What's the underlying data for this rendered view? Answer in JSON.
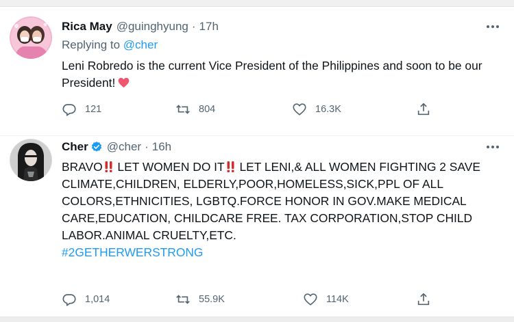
{
  "tweets": [
    {
      "display_name": "Rica May",
      "handle": "@guinghyung",
      "separator": "·",
      "time": "17h",
      "replying_prefix": "Replying to",
      "replying_to": "@cher",
      "text": "Leni Robredo is the current Vice President of the Philippines and soon to be our President!",
      "emoji": "heart",
      "replies": "121",
      "retweets": "804",
      "likes": "16.3K",
      "more_icon": "more-dots-icon"
    },
    {
      "display_name": "Cher",
      "verified": true,
      "handle": "@cher",
      "separator": "·",
      "time": "16h",
      "text_part1": "BRAVO",
      "text_part2": " LET WOMEN DO IT",
      "text_part3": " LET LENI,& ALL WOMEN FIGHTING 2 SAVE CLIMATE,CHILDREN, ELDERLY,POOR,HOMELESS,SICK,PPL OF ALL COLORS,ETHNICITIES, LGBTQ.FORCE HONOR IN GOV.MAKE MEDICAL CARE,EDUCATION, CHILDCARE FREE. TAX CORPORATION,STOP CHILD LABOR.ANIMAL CRUELTY,ETC.",
      "hashtag": "#2GETHERWERSTRONG",
      "emoji": "double-exclamation",
      "replies": "1,014",
      "retweets": "55.9K",
      "likes": "114K",
      "more_icon": "more-dots-icon"
    }
  ],
  "colors": {
    "text": "#0f1419",
    "secondary": "#536471",
    "link": "#1d9bf0",
    "heart_emoji": "#f0566e",
    "exclamation": "#d42d2d",
    "divider": "#eff3f4"
  },
  "icons": [
    "reply-icon",
    "retweet-icon",
    "like-icon",
    "share-icon",
    "verified-badge-icon",
    "more-dots-icon"
  ]
}
